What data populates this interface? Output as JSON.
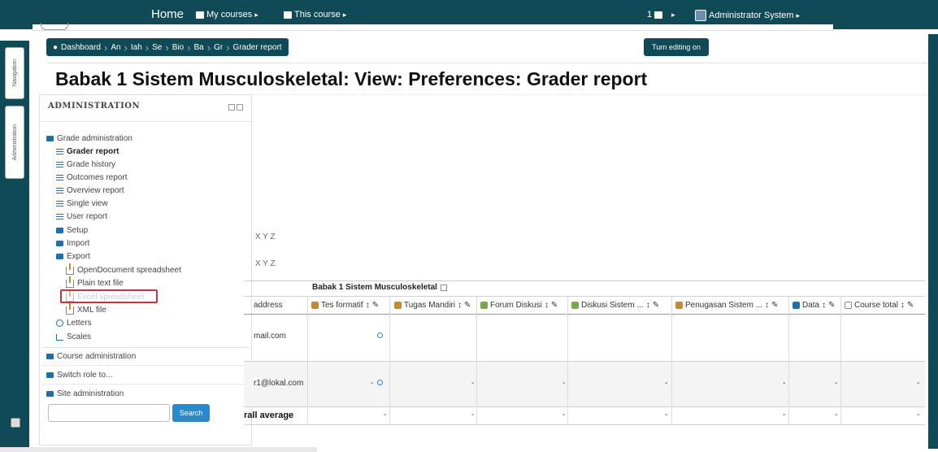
{
  "navbar": {
    "home": "Home",
    "my_courses": "My courses",
    "this_course": "This course",
    "messages": "1",
    "user": "Administrator System"
  },
  "dock": {
    "navigation": "Navigation",
    "administration": "Administration"
  },
  "breadcrumb": {
    "items": [
      "Dashboard",
      "An",
      "Iah",
      "Se",
      "Bio",
      "Ba",
      "Gr",
      "Grader report"
    ]
  },
  "edit_button": "Turn editing on",
  "page_title": "Babak 1 Sistem Musculoskeletal: View: Preferences: Grader report",
  "admin": {
    "heading": "ADMINISTRATION",
    "grade_administration": "Grade administration",
    "grader_report": "Grader report",
    "grade_history": "Grade history",
    "outcomes_report": "Outcomes report",
    "overview_report": "Overview report",
    "single_view": "Single view",
    "user_report": "User report",
    "setup": "Setup",
    "import": "Import",
    "export": "Export",
    "opendocument": "OpenDocument spreadsheet",
    "plain_text": "Plain text file",
    "excel": "Excel spreadsheet",
    "xml": "XML file",
    "letters": "Letters",
    "scales": "Scales",
    "course_administration": "Course administration",
    "switch_role": "Switch role to...",
    "site_administration": "Site administration",
    "search_button": "Search"
  },
  "content": {
    "xyz_1": "X Y Z",
    "xyz_2": "X Y Z"
  },
  "grader": {
    "category": "Babak 1 Sistem Musculoskeletal",
    "columns": {
      "email": "address",
      "c1": "Tes formatif",
      "c2": "Tugas Mandiri",
      "c3": "Forum Diskusi",
      "c4": "Diskusi Sistem ...",
      "c5": "Penugasan Sistem ...",
      "c6": "Data",
      "c7": "Course total"
    },
    "rows": [
      {
        "email": "mail.com",
        "cells": [
          "",
          "",
          "",
          "",
          "",
          "",
          ""
        ]
      },
      {
        "email": "r1@lokal.com",
        "cells": [
          "-",
          "-",
          "-",
          "-",
          "-",
          "-",
          "-"
        ]
      }
    ],
    "average_label": "rall average",
    "average_cells": [
      "-",
      "-",
      "-",
      "-",
      "-",
      "-",
      "-"
    ]
  },
  "colors": {
    "nav_bg": "#0f4a56",
    "link_blue": "#1f6fae",
    "highlight_red": "#c6343e",
    "search_blue": "#2a89c9"
  }
}
